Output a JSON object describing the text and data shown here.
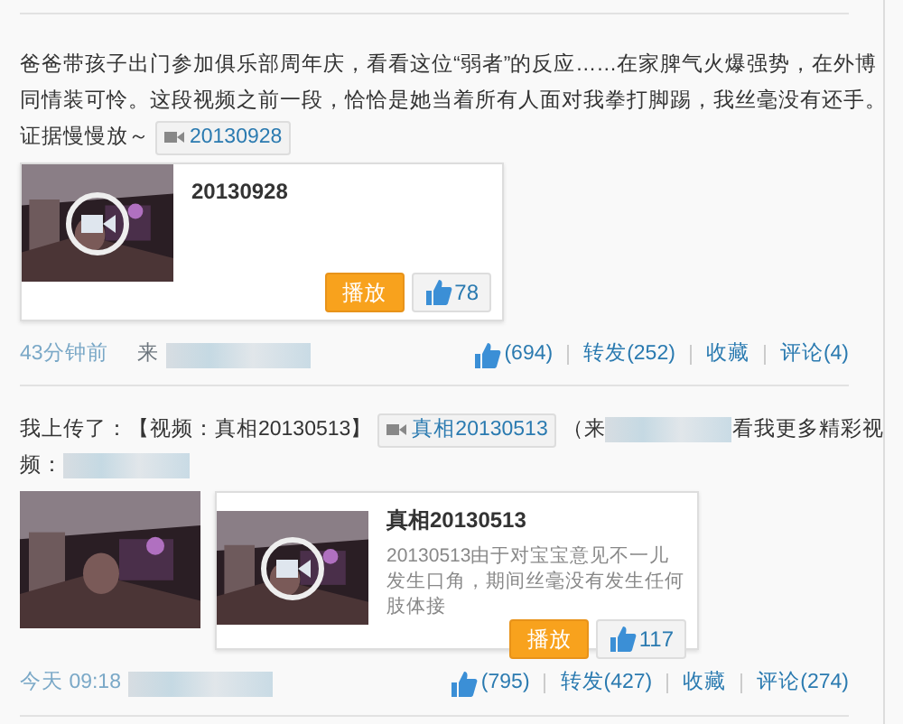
{
  "posts": [
    {
      "lines": [
        [
          {
            "kind": "text",
            "text": "爸爸带孩子出门参加俱乐部周年庆，看看这位“弱者”的反应……在家脾气火爆强势，在外博"
          }
        ],
        [
          {
            "kind": "text",
            "text": "同情装可怜。这段视频之前一段，恰恰是她当着所有人面对我拳打脚踢，我丝毫没有还手。"
          }
        ],
        [
          {
            "kind": "text",
            "text": "证据慢慢放～"
          },
          {
            "kind": "video-link",
            "text": "20130928"
          }
        ]
      ],
      "video_card": {
        "title": "20130928",
        "play": "播放",
        "likes": "78"
      },
      "footer": {
        "time": "43分钟前",
        "source": "来",
        "likes": "(694)",
        "repost": "转发(252)",
        "favorite": "收藏",
        "comment": "评论(4)"
      }
    },
    {
      "lines": [
        [
          {
            "kind": "text",
            "text": "我上传了：【视频：真相20130513】"
          },
          {
            "kind": "video-link",
            "text": "真相20130513"
          },
          {
            "kind": "text",
            "text": "（来"
          },
          {
            "kind": "blurred"
          },
          {
            "kind": "text",
            "text": "看我更多精彩视"
          }
        ],
        [
          {
            "kind": "text",
            "text": "频："
          },
          {
            "kind": "blurred"
          }
        ]
      ],
      "media": [
        {
          "kind": "picture"
        }
      ],
      "video_card": {
        "title": "真相20130513",
        "description": "20130513由于对宝宝意见不一儿发生口角，期间丝毫没有发生任何肢体接",
        "play": "播放",
        "likes": "117"
      },
      "footer": {
        "time": "今天 09:18",
        "likes": "(795)",
        "repost": "转发(427)",
        "favorite": "收藏",
        "comment": "评论(274)"
      }
    }
  ]
}
